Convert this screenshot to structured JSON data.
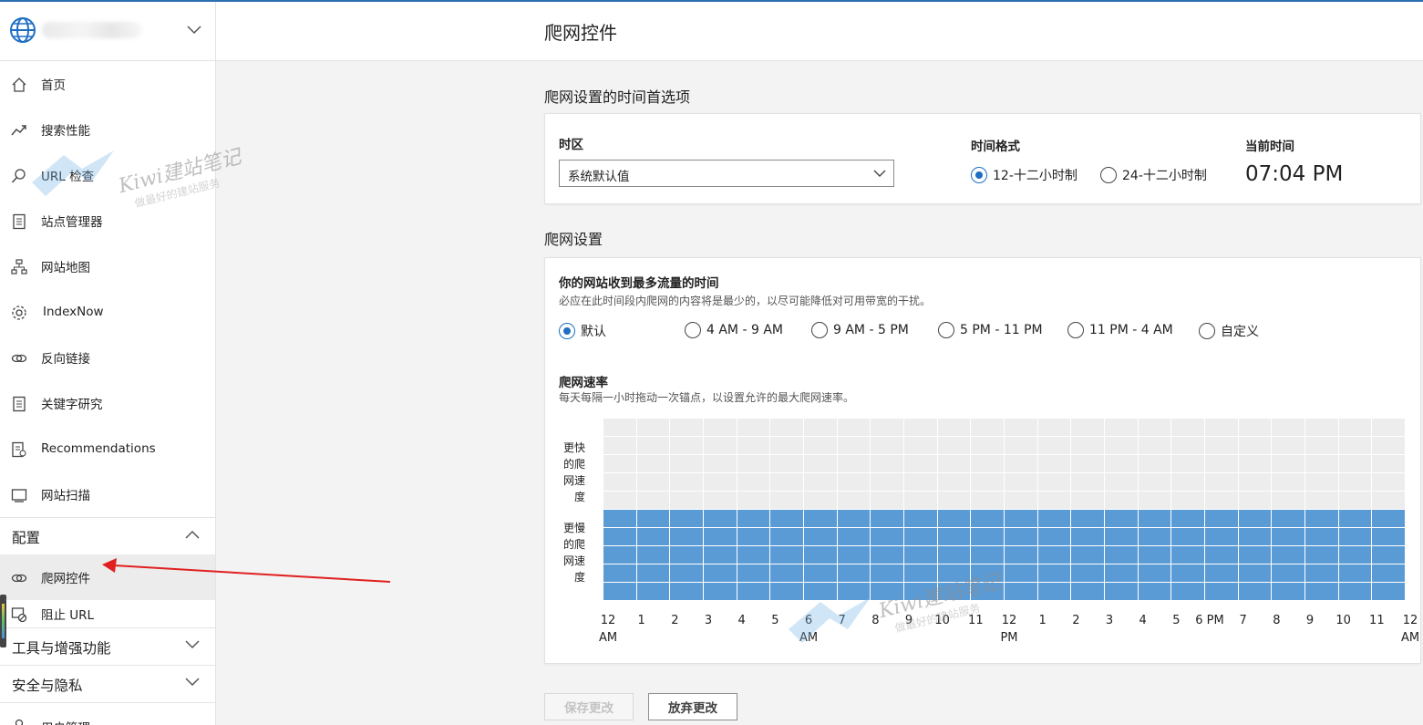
{
  "page_title": "爬网控件",
  "sidebar": {
    "items": [
      {
        "label": "首页",
        "icon": "home-icon"
      },
      {
        "label": "搜索性能",
        "icon": "trend-icon"
      },
      {
        "label": "URL 检查",
        "icon": "search-icon"
      },
      {
        "label": "站点管理器",
        "icon": "document-icon"
      },
      {
        "label": "网站地图",
        "icon": "sitemap-icon"
      },
      {
        "label": "IndexNow",
        "icon": "gear-icon"
      },
      {
        "label": "反向链接",
        "icon": "link-icon"
      },
      {
        "label": "关键字研究",
        "icon": "document-icon"
      },
      {
        "label": "Recommendations",
        "icon": "checklist-icon"
      },
      {
        "label": "网站扫描",
        "icon": "scan-icon"
      }
    ],
    "section_config": "配置",
    "config_items": [
      {
        "label": "爬网控件",
        "icon": "link-icon"
      },
      {
        "label": "阻止 URL",
        "icon": "block-url-icon"
      }
    ],
    "section_tools": "工具与增强功能",
    "section_security": "安全与隐私",
    "item_user_mgmt": "用户管理"
  },
  "time_prefs": {
    "title": "爬网设置的时间首选项",
    "timezone_label": "时区",
    "timezone_value": "系统默认值",
    "format_label": "时间格式",
    "format_options": [
      "12-十二小时制",
      "24-十二小时制"
    ],
    "format_selected": 0,
    "current_time_label": "当前时间",
    "current_time": "07:04 PM"
  },
  "crawl_settings": {
    "title": "爬网设置",
    "traffic_title": "你的网站收到最多流量的时间",
    "traffic_desc": "必应在此时间段内爬网的内容将是最少的，以尽可能降低对可用带宽的干扰。",
    "traffic_options": [
      "默认",
      "4 AM - 9 AM",
      "9 AM - 5 PM",
      "5 PM - 11 PM",
      "11 PM - 4 AM",
      "自定义"
    ],
    "traffic_selected": 0,
    "rate_title": "爬网速率",
    "rate_desc": "每天每隔一小时拖动一次锚点，以设置允许的最大爬网速率。",
    "y_top": [
      "更快",
      "的爬",
      "网速",
      "度"
    ],
    "y_bottom": [
      "更慢",
      "的爬",
      "网速",
      "度"
    ]
  },
  "chart_data": {
    "type": "bar",
    "hour_labels": [
      [
        "12",
        "AM"
      ],
      [
        "1"
      ],
      [
        "2"
      ],
      [
        "3"
      ],
      [
        "4"
      ],
      [
        "5"
      ],
      [
        "6",
        "AM"
      ],
      [
        "7"
      ],
      [
        "8"
      ],
      [
        "9"
      ],
      [
        "10"
      ],
      [
        "11"
      ],
      [
        "12",
        "PM"
      ],
      [
        "1"
      ],
      [
        "2"
      ],
      [
        "3"
      ],
      [
        "4"
      ],
      [
        "5"
      ],
      [
        "6 PM"
      ],
      [
        "7"
      ],
      [
        "8"
      ],
      [
        "9"
      ],
      [
        "10"
      ],
      [
        "11"
      ],
      [
        "12",
        "AM"
      ]
    ],
    "levels_total": 10,
    "values": [
      5,
      5,
      5,
      5,
      5,
      5,
      5,
      5,
      5,
      5,
      5,
      5,
      5,
      5,
      5,
      5,
      5,
      5,
      5,
      5,
      5,
      5,
      5,
      5
    ],
    "ylim": [
      0,
      10
    ],
    "on_color": "#5b9bd5",
    "off_color": "#ededed"
  },
  "buttons": {
    "save": "保存更改",
    "discard": "放弃更改"
  },
  "watermark": {
    "title": "Kiwi建站笔记",
    "subtitle": "做最好的建站服务"
  }
}
